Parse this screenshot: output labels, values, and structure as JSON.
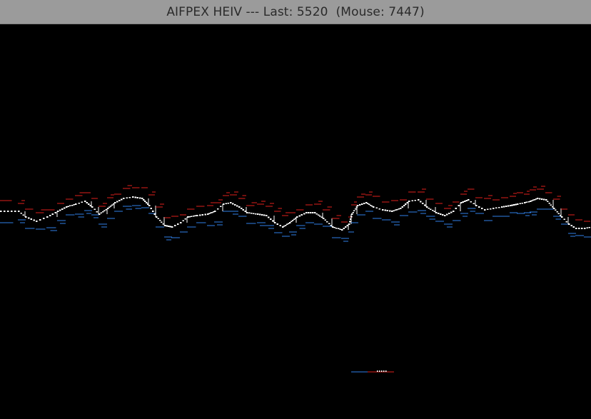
{
  "window": {
    "title": "AIFPEX HEIV --- Last: 5520  (Mouse: 7447)"
  },
  "colors": {
    "background": "#000000",
    "titlebar": "#9b9b9b",
    "title_text": "#2a2a2a",
    "upper_band": "#e0211c",
    "lower_band": "#2f7fe8",
    "price_marks": "#ffffff"
  }
}
